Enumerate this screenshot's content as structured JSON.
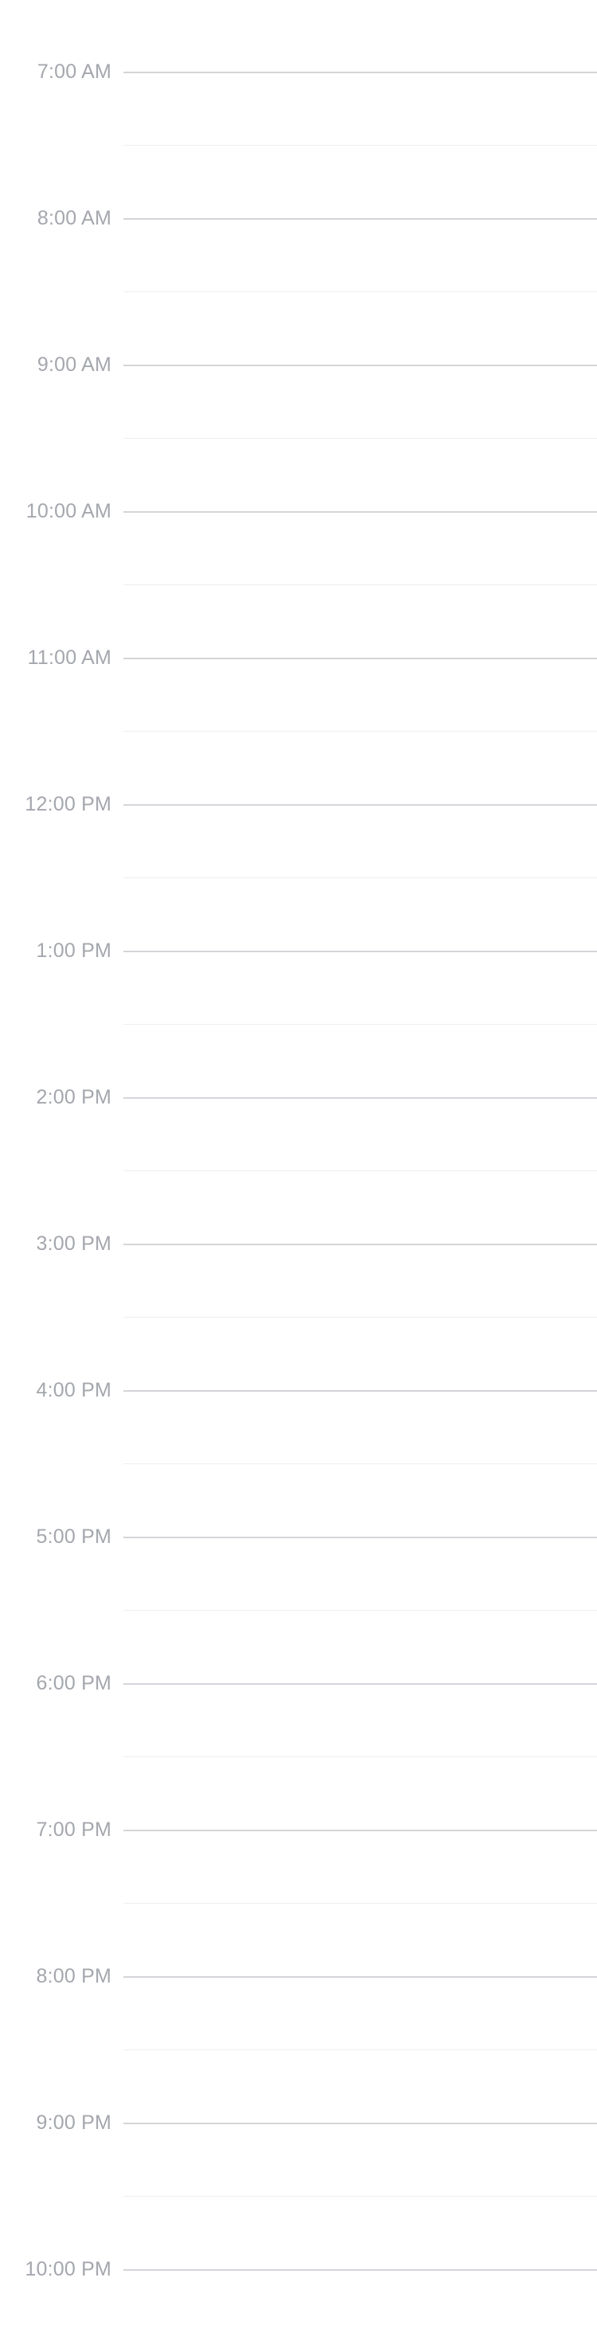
{
  "schedule": {
    "hours": [
      {
        "label": "7:00 AM"
      },
      {
        "label": "8:00 AM"
      },
      {
        "label": "9:00 AM"
      },
      {
        "label": "10:00 AM"
      },
      {
        "label": "11:00 AM"
      },
      {
        "label": "12:00 PM"
      },
      {
        "label": "1:00 PM"
      },
      {
        "label": "2:00 PM"
      },
      {
        "label": "3:00 PM"
      },
      {
        "label": "4:00 PM"
      },
      {
        "label": "5:00 PM"
      },
      {
        "label": "6:00 PM"
      },
      {
        "label": "7:00 PM"
      },
      {
        "label": "8:00 PM"
      },
      {
        "label": "9:00 PM"
      },
      {
        "label": "10:00 PM"
      }
    ]
  }
}
